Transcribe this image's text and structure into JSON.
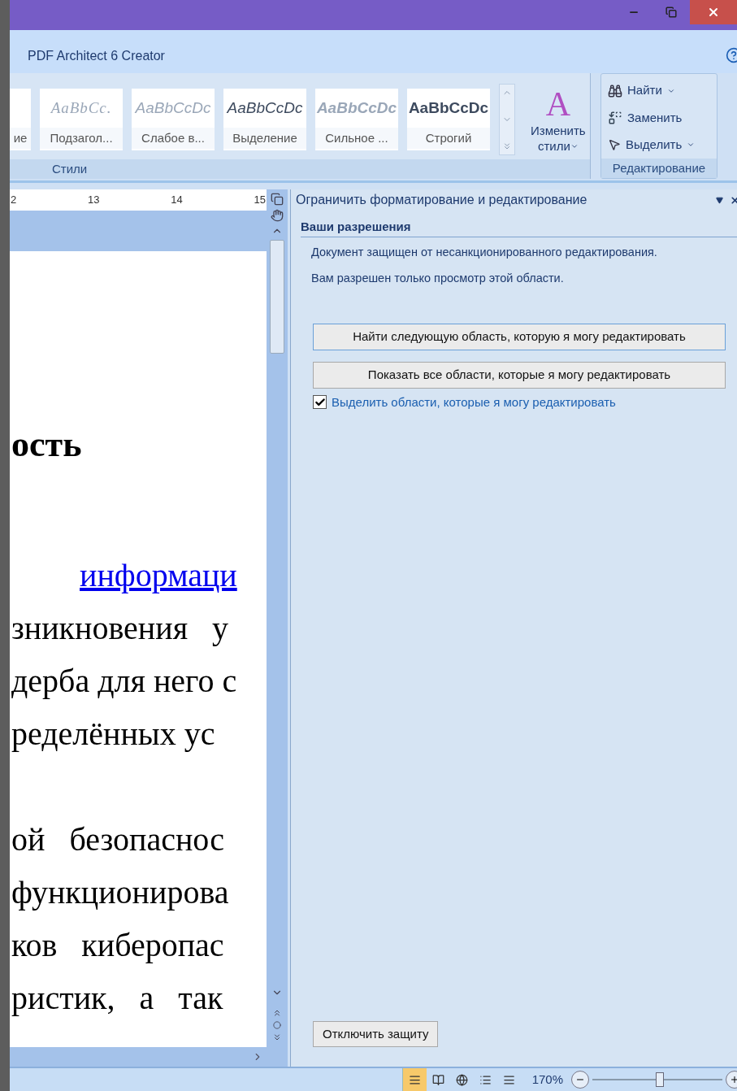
{
  "ribbon_tab": "PDF Architect 6 Creator",
  "styles_group": {
    "label": "Стили",
    "items": [
      {
        "kind": "normal",
        "label": "ие"
      },
      {
        "kind": "subtitle",
        "sample": "AaBbCc.",
        "label": "Подзагол..."
      },
      {
        "kind": "subtle",
        "sample": "AaBbCcDc",
        "label": "Слабое в..."
      },
      {
        "kind": "emphasis",
        "sample": "AaBbCcDc",
        "label": "Выделение"
      },
      {
        "kind": "intense",
        "sample": "AaBbCcDc",
        "label": "Сильное ..."
      },
      {
        "kind": "strong",
        "sample": "AaBbCcDc",
        "label": "Строгий"
      }
    ],
    "change_styles": [
      "Изменить",
      "стили"
    ],
    "change_styles_glyph": "A"
  },
  "editing_group": {
    "label": "Редактирование",
    "items": [
      {
        "kind": "find",
        "label": "Найти",
        "dropdown": true
      },
      {
        "kind": "replace",
        "label": "Заменить",
        "dropdown": false
      },
      {
        "kind": "select",
        "label": "Выделить",
        "dropdown": true
      }
    ]
  },
  "ruler": [
    "2",
    "13",
    "14",
    "15"
  ],
  "document": {
    "lines": [
      {
        "kind": "heading",
        "text": "ость"
      },
      {
        "kind": "link",
        "text": "информаци"
      },
      {
        "kind": "body",
        "text": "зникновения   у"
      },
      {
        "kind": "body",
        "text": "дерба для него с"
      },
      {
        "kind": "body",
        "text": "ределённых ус"
      },
      {
        "kind": "gap"
      },
      {
        "kind": "body",
        "text": "ой   безопаснос"
      },
      {
        "kind": "body",
        "text": "функционирова"
      },
      {
        "kind": "body",
        "text": "ков   киберопас"
      },
      {
        "kind": "body",
        "text": "ристик,   а   так"
      }
    ]
  },
  "task_pane": {
    "title": "Ограничить форматирование и редактирование",
    "section": "Ваши разрешения",
    "messages": [
      "Документ защищен от несанкционированного редактирования.",
      "Вам разрешен только просмотр этой области."
    ],
    "buttons": [
      "Найти следующую область, которую я могу редактировать",
      "Показать все области, которые я могу редактировать"
    ],
    "highlight": {
      "label": "Выделить области, которые я могу редактировать",
      "checked": true
    },
    "stop_button": "Отключить защиту"
  },
  "status_bar": {
    "views": [
      {
        "selected": true
      },
      {
        "selected": false
      },
      {
        "selected": false
      },
      {
        "selected": false
      },
      {
        "selected": false
      }
    ],
    "zoom": "170%",
    "zoom_slider": {
      "level": 0.52
    }
  }
}
